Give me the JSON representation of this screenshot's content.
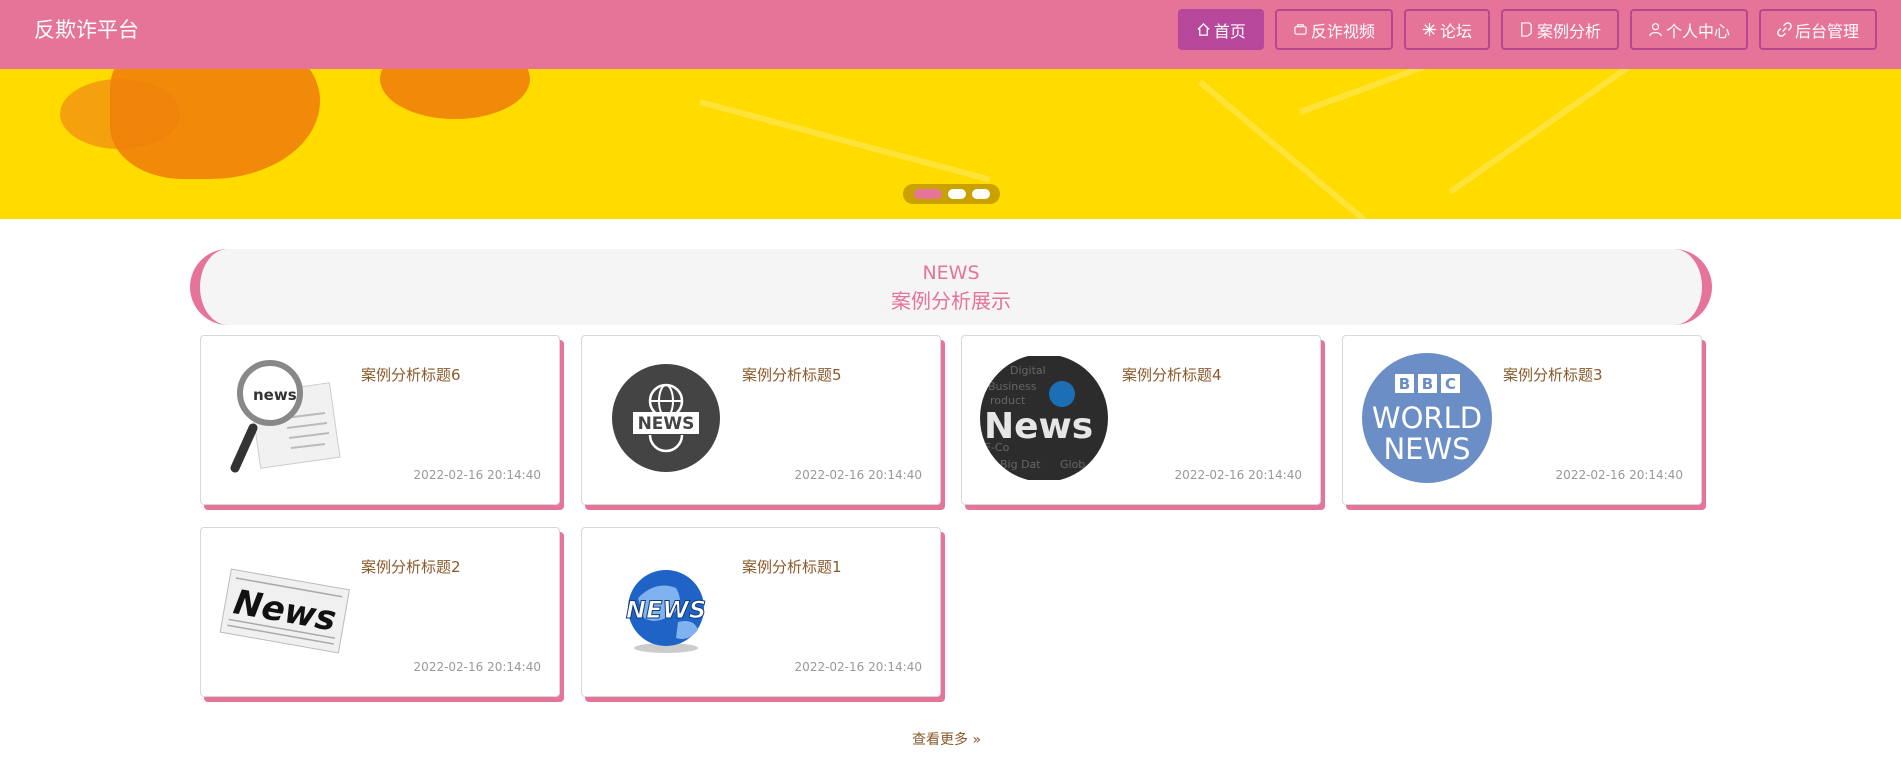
{
  "header": {
    "brand": "反欺诈平台",
    "nav": [
      {
        "label": "首页",
        "icon": "home-icon",
        "active": true
      },
      {
        "label": "反诈视频",
        "icon": "video-icon"
      },
      {
        "label": "论坛",
        "icon": "forum-icon"
      },
      {
        "label": "案例分析",
        "icon": "document-icon"
      },
      {
        "label": "个人中心",
        "icon": "user-icon"
      },
      {
        "label": "后台管理",
        "icon": "link-icon"
      }
    ]
  },
  "banner": {
    "slides": 3,
    "active_slide": 1,
    "colors": {
      "background": "#ffdb00",
      "accent": "#f07f0a"
    }
  },
  "section": {
    "title_en": "NEWS",
    "title_cn": "案例分析展示"
  },
  "cards": [
    {
      "title": "案例分析标题6",
      "time": "2022-02-16 20:14:40",
      "thumb": "magnifier-news-icon"
    },
    {
      "title": "案例分析标题5",
      "time": "2022-02-16 20:14:40",
      "thumb": "globe-news-badge-icon",
      "thumb_text": "NEWS"
    },
    {
      "title": "案例分析标题4",
      "time": "2022-02-16 20:14:40",
      "thumb": "digital-news-icon",
      "thumb_text": "News"
    },
    {
      "title": "案例分析标题3",
      "time": "2022-02-16 20:14:40",
      "thumb": "bbc-world-news-logo",
      "thumb_text": "BBC WORLD NEWS"
    },
    {
      "title": "案例分析标题2",
      "time": "2022-02-16 20:14:40",
      "thumb": "newspaper-icon",
      "thumb_text": "News"
    },
    {
      "title": "案例分析标题1",
      "time": "2022-02-16 20:14:40",
      "thumb": "blue-globe-news-icon",
      "thumb_text": "NEWS"
    }
  ],
  "more_label": "查看更多",
  "colors": {
    "primary": "#e57498",
    "nav_active": "#b7479b",
    "title_text": "#8a5a2b"
  }
}
